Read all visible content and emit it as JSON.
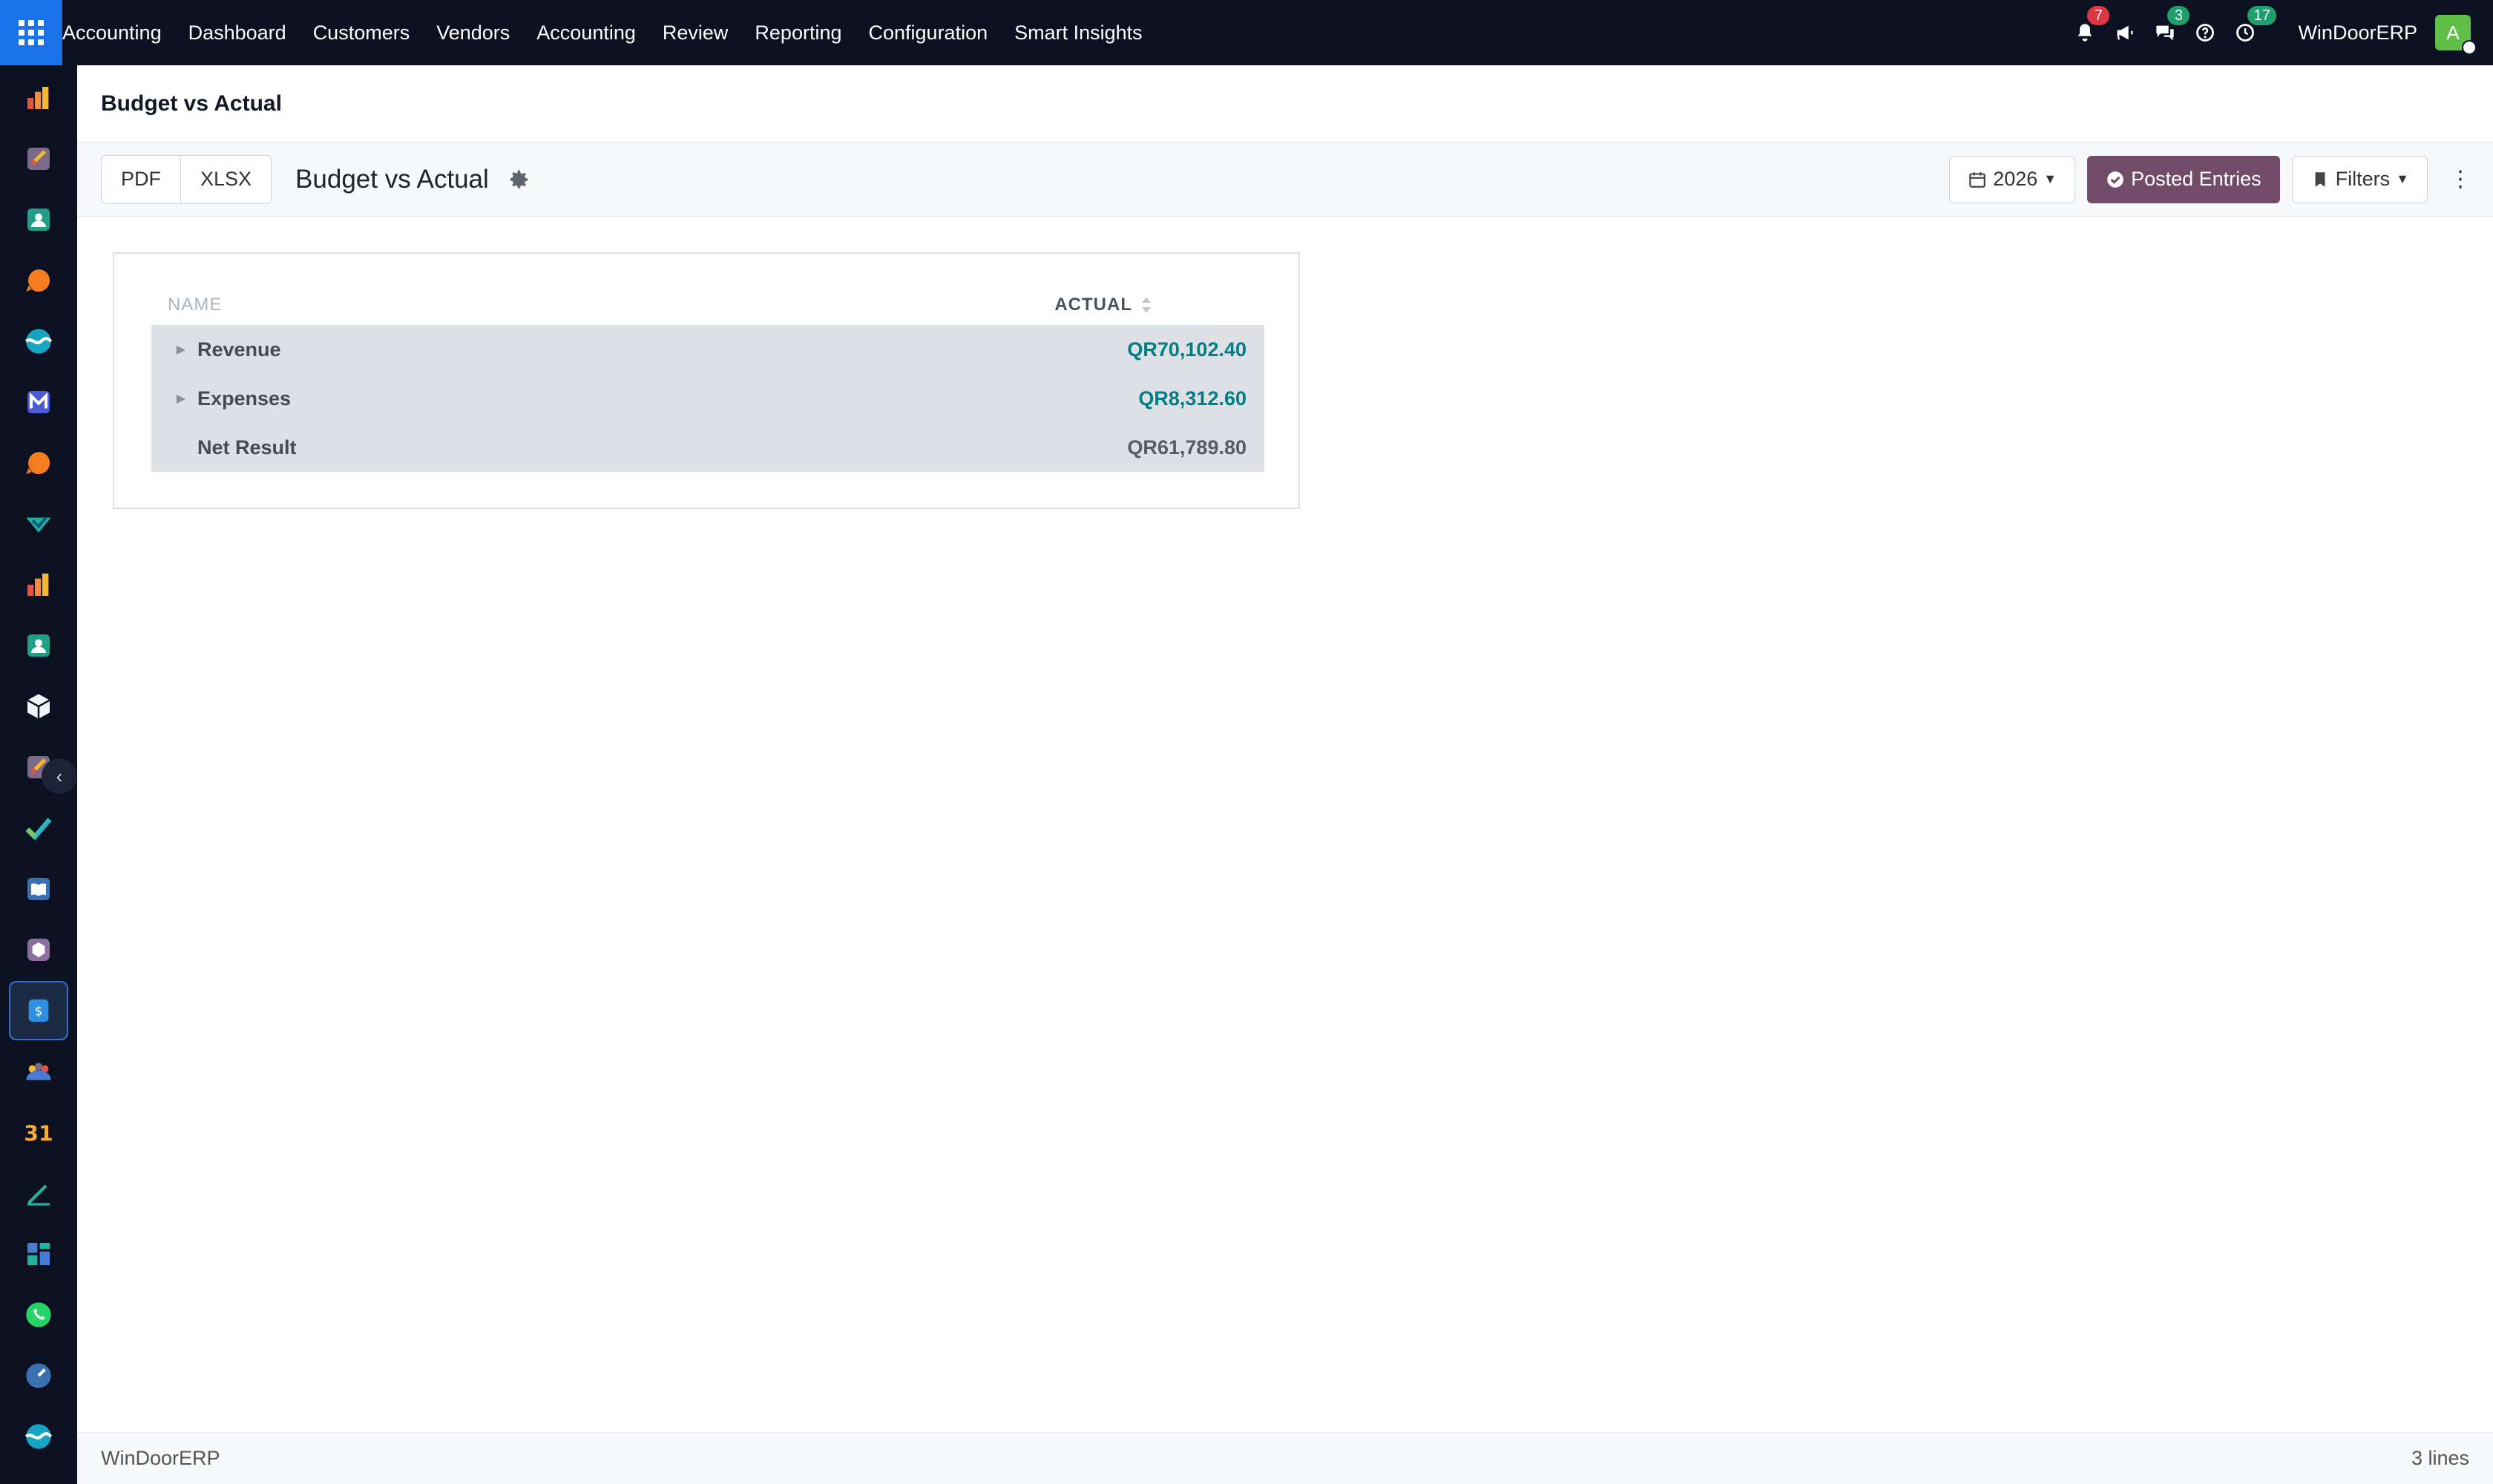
{
  "topbar": {
    "brand": "Accounting",
    "menu": [
      {
        "label": "Dashboard"
      },
      {
        "label": "Customers"
      },
      {
        "label": "Vendors"
      },
      {
        "label": "Accounting"
      },
      {
        "label": "Review"
      },
      {
        "label": "Reporting"
      },
      {
        "label": "Configuration"
      },
      {
        "label": "Smart Insights"
      }
    ],
    "notifications_count": "7",
    "messages_count": "3",
    "activities_count": "17",
    "company": "WinDoorERP",
    "avatar_letter": "A",
    "icons": [
      "apps-grid-icon",
      "bell-icon",
      "megaphone-icon",
      "chat-icon",
      "help-icon",
      "clock-icon"
    ]
  },
  "breadcrumb": {
    "title": "Budget vs Actual"
  },
  "controls": {
    "export_pdf": "PDF",
    "export_xlsx": "XLSX",
    "report_title": "Budget vs Actual",
    "period": "2026",
    "posted_entries": "Posted Entries",
    "filters": "Filters"
  },
  "table": {
    "col_name": "NAME",
    "col_actual": "ACTUAL",
    "rows": [
      {
        "label": "Revenue",
        "amount": "QR70,102.40"
      },
      {
        "label": "Expenses",
        "amount": "QR8,312.60"
      },
      {
        "label": "Net Result",
        "amount": "QR61,789.80"
      }
    ]
  },
  "footer": {
    "company": "WinDoorERP",
    "lines": "3 lines"
  },
  "colors": {
    "topbar_bg": "#0b1120",
    "apps_button": "#1a73e8",
    "primary_button": "#714b67",
    "link_amount": "#017e84",
    "badge_red": "#e03545",
    "badge_green": "#1f9e6e"
  }
}
